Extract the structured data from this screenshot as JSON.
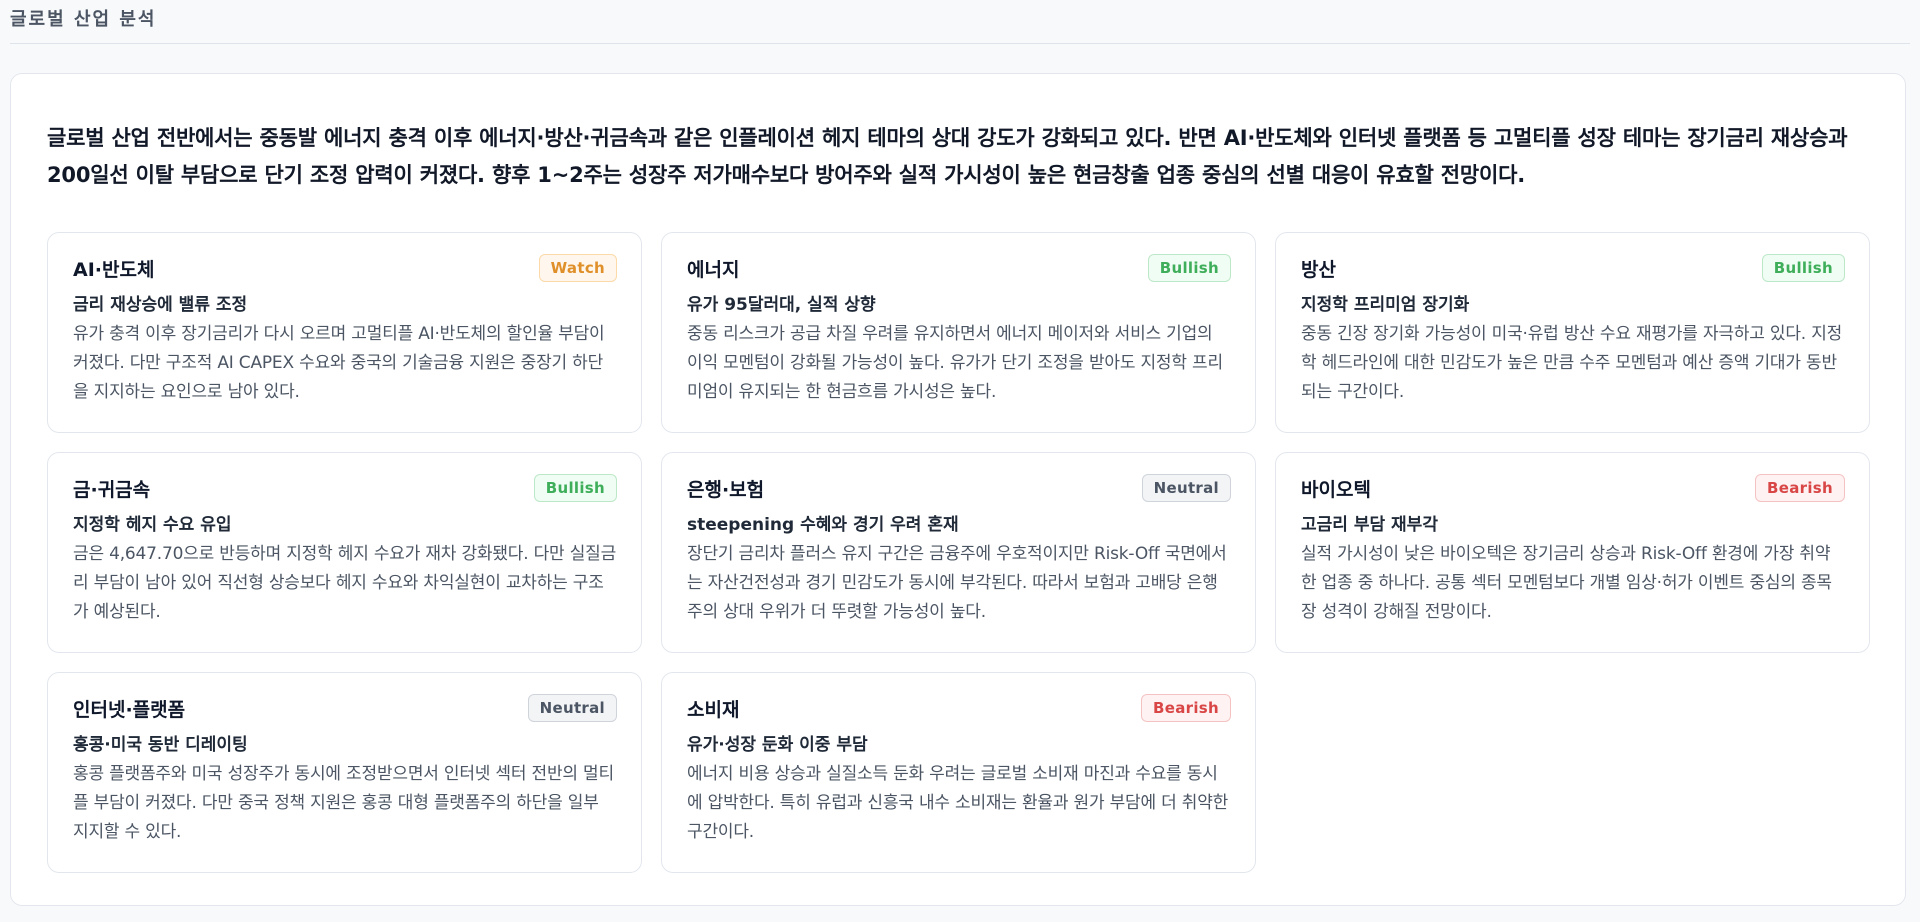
{
  "header": {
    "title": "글로벌 산업 분석"
  },
  "summary": "글로벌 산업 전반에서는 중동발 에너지 충격 이후 에너지·방산·귀금속과 같은 인플레이션 헤지 테마의 상대 강도가 강화되고 있다. 반면 AI·반도체와 인터넷 플랫폼 등 고멀티플 성장 테마는 장기금리 재상승과 200일선 이탈 부담으로 단기 조정 압력이 커졌다. 향후 1~2주는 성장주 저가매수보다 방어주와 실적 가시성이 높은 현금창출 업종 중심의 선별 대응이 유효할 전망이다.",
  "sectors": [
    {
      "name": "AI·반도체",
      "badge": "Watch",
      "headline": "금리 재상승에 밸류 조정",
      "body": "유가 충격 이후 장기금리가 다시 오르며 고멀티플 AI·반도체의 할인율 부담이 커졌다. 다만 구조적 AI CAPEX 수요와 중국의 기술금융 지원은 중장기 하단을 지지하는 요인으로 남아 있다."
    },
    {
      "name": "에너지",
      "badge": "Bullish",
      "headline": "유가 95달러대, 실적 상향",
      "body": "중동 리스크가 공급 차질 우려를 유지하면서 에너지 메이저와 서비스 기업의 이익 모멘텀이 강화될 가능성이 높다. 유가가 단기 조정을 받아도 지정학 프리미엄이 유지되는 한 현금흐름 가시성은 높다."
    },
    {
      "name": "방산",
      "badge": "Bullish",
      "headline": "지정학 프리미엄 장기화",
      "body": "중동 긴장 장기화 가능성이 미국·유럽 방산 수요 재평가를 자극하고 있다. 지정학 헤드라인에 대한 민감도가 높은 만큼 수주 모멘텀과 예산 증액 기대가 동반되는 구간이다."
    },
    {
      "name": "금·귀금속",
      "badge": "Bullish",
      "headline": "지정학 헤지 수요 유입",
      "body": "금은 4,647.70으로 반등하며 지정학 헤지 수요가 재차 강화됐다. 다만 실질금리 부담이 남아 있어 직선형 상승보다 헤지 수요와 차익실현이 교차하는 구조가 예상된다."
    },
    {
      "name": "은행·보험",
      "badge": "Neutral",
      "headline": "steepening 수혜와 경기 우려 혼재",
      "body": "장단기 금리차 플러스 유지 구간은 금융주에 우호적이지만 Risk-Off 국면에서는 자산건전성과 경기 민감도가 동시에 부각된다. 따라서 보험과 고배당 은행주의 상대 우위가 더 뚜렷할 가능성이 높다."
    },
    {
      "name": "바이오텍",
      "badge": "Bearish",
      "headline": "고금리 부담 재부각",
      "body": "실적 가시성이 낮은 바이오텍은 장기금리 상승과 Risk-Off 환경에 가장 취약한 업종 중 하나다. 공통 섹터 모멘텀보다 개별 임상·허가 이벤트 중심의 종목장 성격이 강해질 전망이다."
    },
    {
      "name": "인터넷·플랫폼",
      "badge": "Neutral",
      "headline": "홍콩·미국 동반 디레이팅",
      "body": "홍콩 플랫폼주와 미국 성장주가 동시에 조정받으면서 인터넷 섹터 전반의 멀티플 부담이 커졌다. 다만 중국 정책 지원은 홍콩 대형 플랫폼주의 하단을 일부 지지할 수 있다."
    },
    {
      "name": "소비재",
      "badge": "Bearish",
      "headline": "유가·성장 둔화 이중 부담",
      "body": "에너지 비용 상승과 실질소득 둔화 우려는 글로벌 소비재 마진과 수요를 동시에 압박한다. 특히 유럽과 신흥국 내수 소비재는 환율과 원가 부담에 더 취약한 구간이다."
    }
  ]
}
